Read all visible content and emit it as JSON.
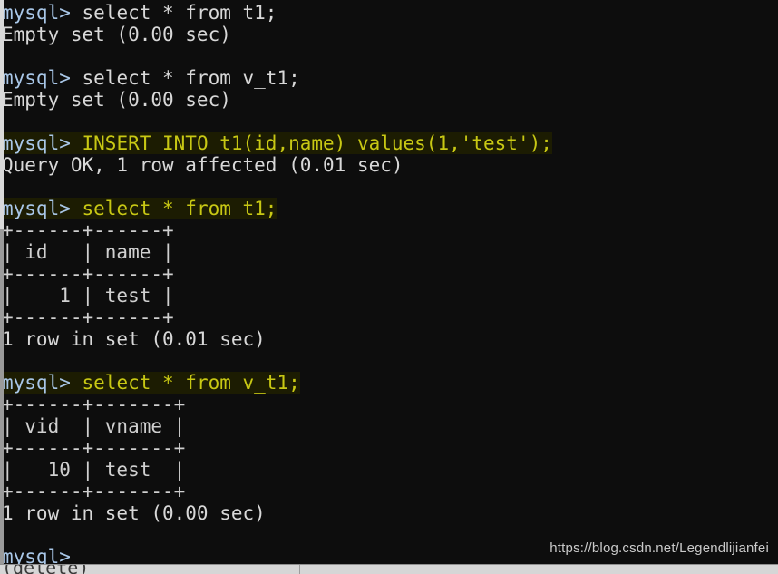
{
  "window": {
    "kind": "terminal",
    "background_color": "#0d0d0d",
    "prompt_color": "#a9c7e8",
    "output_color": "#d8d8d8",
    "highlight_text_color": "#c8c814",
    "highlight_background_color": "#1c1c02"
  },
  "prompt": "mysql> ",
  "terminal_lines": [
    {
      "prompt": "mysql> ",
      "command": "select * from t1;",
      "highlighted": false
    },
    {
      "output": "Empty set (0.00 sec)"
    },
    {
      "output": ""
    },
    {
      "prompt": "mysql> ",
      "command": "select * from v_t1;",
      "highlighted": false
    },
    {
      "output": "Empty set (0.00 sec)"
    },
    {
      "output": ""
    },
    {
      "prompt": "mysql> ",
      "command": "INSERT INTO t1(id,name) values(1,'test');",
      "highlighted": true
    },
    {
      "output": "Query OK, 1 row affected (0.01 sec)"
    },
    {
      "output": ""
    },
    {
      "prompt": "mysql> ",
      "command": "select * from t1;",
      "highlighted": true
    },
    {
      "output": "+------+------+"
    },
    {
      "output": "| id   | name |"
    },
    {
      "output": "+------+------+"
    },
    {
      "output": "|    1 | test |"
    },
    {
      "output": "+------+------+"
    },
    {
      "output": "1 row in set (0.01 sec)"
    },
    {
      "output": ""
    },
    {
      "prompt": "mysql> ",
      "command": "select * from v_t1;",
      "highlighted": true
    },
    {
      "output": "+------+-------+"
    },
    {
      "output": "| vid  | vname |"
    },
    {
      "output": "+------+-------+"
    },
    {
      "output": "|   10 | test  |"
    },
    {
      "output": "+------+-------+"
    },
    {
      "output": "1 row in set (0.00 sec)"
    },
    {
      "output": ""
    },
    {
      "prompt": "mysql> ",
      "command": "",
      "highlighted": false
    }
  ],
  "tables": [
    {
      "name": "t1-result",
      "columns": [
        "id",
        "name"
      ],
      "rows": [
        [
          "1",
          "test"
        ]
      ],
      "footer": "1 row in set (0.01 sec)"
    },
    {
      "name": "v_t1-result",
      "columns": [
        "vid",
        "vname"
      ],
      "rows": [
        [
          "10",
          "test"
        ]
      ],
      "footer": "1 row in set (0.00 sec)"
    }
  ],
  "watermark": {
    "text": "https://blog.csdn.net/Legendlijianfei"
  },
  "bottom_bar": {
    "clipped_text": "(delete)"
  }
}
